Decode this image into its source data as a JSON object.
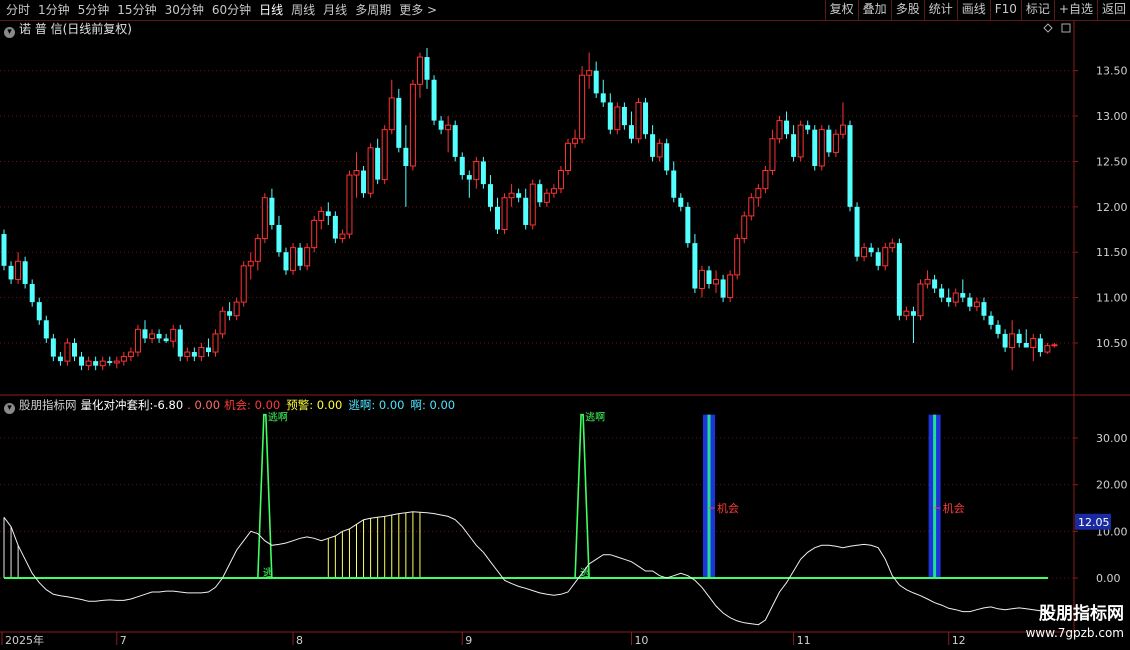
{
  "toolbar": {
    "periods": [
      "分时",
      "1分钟",
      "5分钟",
      "15分钟",
      "30分钟",
      "60分钟",
      "日线",
      "周线",
      "月线",
      "多周期",
      "更多 >"
    ],
    "active_period": "日线",
    "right_buttons": [
      "复权",
      "叠加",
      "多股",
      "统计",
      "画线",
      "F10",
      "标记",
      "+自选",
      "返回"
    ]
  },
  "price_panel": {
    "title": "诺 普 信(日线前复权)",
    "y_ticks": [
      "13.50",
      "13.00",
      "12.50",
      "12.00",
      "11.50",
      "11.00",
      "10.50"
    ],
    "y_tick_values": [
      13.5,
      13.0,
      12.5,
      12.0,
      11.5,
      11.0,
      10.5
    ],
    "y_range": [
      10.07,
      13.86
    ],
    "up_color": "#ff3232",
    "down_color": "#54ffff"
  },
  "indicator_panel": {
    "title": "股朋指标网",
    "name": "量化对冲套利:",
    "value": "-6.80",
    "extra": ". 0.00",
    "fields": [
      {
        "label": "机会: 0.00",
        "color": "#ff3a3a"
      },
      {
        "label": "预警: 0.00",
        "color": "#ffff40"
      },
      {
        "label": "逃啊: 0.00",
        "color": "#4ce4ff"
      },
      {
        "label": "啊: 0.00",
        "color": "#4ce4ff"
      }
    ],
    "y_ticks": [
      "30.00",
      "20.00",
      "10.00",
      "0.00"
    ],
    "y_tick_values": [
      30,
      20,
      10,
      0
    ],
    "y_range": [
      -10,
      35
    ],
    "current_value_label": "12.05",
    "annot_escape_top": "逃啊",
    "annot_escape_bottom": "逃",
    "annot_opportunity": "机会"
  },
  "x_axis": {
    "labels": [
      "2025年",
      "7",
      "8",
      "9",
      "10",
      "11",
      "12"
    ],
    "label_bars": [
      0,
      16,
      41,
      65,
      89,
      112,
      134
    ]
  },
  "watermark": {
    "title": "股朋指标网",
    "url": "www.7gpzb.com"
  },
  "chart_data": {
    "type": "candlestick",
    "bar_count": 150,
    "ohlc": [
      [
        11.7,
        11.75,
        11.3,
        11.35
      ],
      [
        11.35,
        11.4,
        11.15,
        11.2
      ],
      [
        11.2,
        11.5,
        11.15,
        11.4
      ],
      [
        11.4,
        11.45,
        11.1,
        11.15
      ],
      [
        11.15,
        11.2,
        10.9,
        10.95
      ],
      [
        10.95,
        11.0,
        10.7,
        10.75
      ],
      [
        10.75,
        10.8,
        10.5,
        10.55
      ],
      [
        10.55,
        10.6,
        10.3,
        10.35
      ],
      [
        10.35,
        10.4,
        10.25,
        10.3
      ],
      [
        10.3,
        10.55,
        10.25,
        10.5
      ],
      [
        10.5,
        10.55,
        10.3,
        10.35
      ],
      [
        10.35,
        10.4,
        10.2,
        10.25
      ],
      [
        10.25,
        10.35,
        10.2,
        10.3
      ],
      [
        10.3,
        10.35,
        10.2,
        10.25
      ],
      [
        10.25,
        10.35,
        10.2,
        10.3
      ],
      [
        10.3,
        10.35,
        10.25,
        10.28
      ],
      [
        10.28,
        10.35,
        10.22,
        10.3
      ],
      [
        10.3,
        10.4,
        10.25,
        10.35
      ],
      [
        10.35,
        10.45,
        10.3,
        10.4
      ],
      [
        10.4,
        10.7,
        10.35,
        10.65
      ],
      [
        10.65,
        10.75,
        10.5,
        10.55
      ],
      [
        10.55,
        10.65,
        10.5,
        10.6
      ],
      [
        10.6,
        10.65,
        10.5,
        10.55
      ],
      [
        10.55,
        10.6,
        10.5,
        10.52
      ],
      [
        10.52,
        10.7,
        10.45,
        10.65
      ],
      [
        10.65,
        10.7,
        10.3,
        10.35
      ],
      [
        10.35,
        10.45,
        10.3,
        10.4
      ],
      [
        10.4,
        10.45,
        10.3,
        10.35
      ],
      [
        10.35,
        10.5,
        10.3,
        10.45
      ],
      [
        10.45,
        10.55,
        10.35,
        10.4
      ],
      [
        10.4,
        10.65,
        10.35,
        10.6
      ],
      [
        10.6,
        10.9,
        10.55,
        10.85
      ],
      [
        10.85,
        10.95,
        10.75,
        10.8
      ],
      [
        10.8,
        11.0,
        10.75,
        10.95
      ],
      [
        10.95,
        11.4,
        10.9,
        11.35
      ],
      [
        11.35,
        11.5,
        11.2,
        11.4
      ],
      [
        11.4,
        11.7,
        11.3,
        11.65
      ],
      [
        11.65,
        12.15,
        11.6,
        12.1
      ],
      [
        12.1,
        12.2,
        11.75,
        11.8
      ],
      [
        11.8,
        11.9,
        11.45,
        11.5
      ],
      [
        11.5,
        11.55,
        11.25,
        11.3
      ],
      [
        11.3,
        11.6,
        11.25,
        11.55
      ],
      [
        11.55,
        11.6,
        11.3,
        11.35
      ],
      [
        11.35,
        11.6,
        11.3,
        11.55
      ],
      [
        11.55,
        11.9,
        11.5,
        11.85
      ],
      [
        11.85,
        12.0,
        11.75,
        11.95
      ],
      [
        11.95,
        12.05,
        11.8,
        11.9
      ],
      [
        11.9,
        11.95,
        11.6,
        11.65
      ],
      [
        11.65,
        11.75,
        11.6,
        11.7
      ],
      [
        11.7,
        12.4,
        11.65,
        12.35
      ],
      [
        12.35,
        12.6,
        12.1,
        12.4
      ],
      [
        12.4,
        12.45,
        12.1,
        12.15
      ],
      [
        12.15,
        12.7,
        12.1,
        12.65
      ],
      [
        12.65,
        12.75,
        12.25,
        12.3
      ],
      [
        12.3,
        12.9,
        12.25,
        12.85
      ],
      [
        12.85,
        13.4,
        12.8,
        13.2
      ],
      [
        13.2,
        13.3,
        12.6,
        12.65
      ],
      [
        12.65,
        12.9,
        12.0,
        12.45
      ],
      [
        12.45,
        13.4,
        12.4,
        13.35
      ],
      [
        13.35,
        13.7,
        13.2,
        13.65
      ],
      [
        13.65,
        13.75,
        13.3,
        13.4
      ],
      [
        13.4,
        13.45,
        12.9,
        12.95
      ],
      [
        12.95,
        13.0,
        12.8,
        12.85
      ],
      [
        12.85,
        13.0,
        12.6,
        12.9
      ],
      [
        12.9,
        12.95,
        12.5,
        12.55
      ],
      [
        12.55,
        12.6,
        12.3,
        12.35
      ],
      [
        12.35,
        12.4,
        12.1,
        12.3
      ],
      [
        12.3,
        12.55,
        12.2,
        12.5
      ],
      [
        12.5,
        12.55,
        12.2,
        12.25
      ],
      [
        12.25,
        12.35,
        11.95,
        12.0
      ],
      [
        12.0,
        12.1,
        11.7,
        11.75
      ],
      [
        11.75,
        12.15,
        11.7,
        12.1
      ],
      [
        12.1,
        12.25,
        12.0,
        12.15
      ],
      [
        12.15,
        12.2,
        12.05,
        12.1
      ],
      [
        12.1,
        12.2,
        11.75,
        11.8
      ],
      [
        11.8,
        12.3,
        11.75,
        12.25
      ],
      [
        12.25,
        12.3,
        12.0,
        12.05
      ],
      [
        12.05,
        12.2,
        12.0,
        12.15
      ],
      [
        12.15,
        12.25,
        12.1,
        12.2
      ],
      [
        12.2,
        12.45,
        12.15,
        12.4
      ],
      [
        12.4,
        12.75,
        12.35,
        12.7
      ],
      [
        12.7,
        12.85,
        12.65,
        12.75
      ],
      [
        12.75,
        13.55,
        12.7,
        13.45
      ],
      [
        13.45,
        13.7,
        13.3,
        13.5
      ],
      [
        13.5,
        13.6,
        13.2,
        13.25
      ],
      [
        13.25,
        13.4,
        13.1,
        13.15
      ],
      [
        13.15,
        13.25,
        12.8,
        12.85
      ],
      [
        12.85,
        13.15,
        12.8,
        13.1
      ],
      [
        13.1,
        13.15,
        12.85,
        12.9
      ],
      [
        12.9,
        13.05,
        12.7,
        12.75
      ],
      [
        12.75,
        13.2,
        12.7,
        13.15
      ],
      [
        13.15,
        13.2,
        12.75,
        12.8
      ],
      [
        12.8,
        12.9,
        12.5,
        12.55
      ],
      [
        12.55,
        12.75,
        12.5,
        12.7
      ],
      [
        12.7,
        12.75,
        12.35,
        12.4
      ],
      [
        12.4,
        12.5,
        12.05,
        12.1
      ],
      [
        12.1,
        12.15,
        11.95,
        12.0
      ],
      [
        12.0,
        12.05,
        11.55,
        11.6
      ],
      [
        11.6,
        11.7,
        11.05,
        11.1
      ],
      [
        11.1,
        11.35,
        11.0,
        11.3
      ],
      [
        11.3,
        11.35,
        11.1,
        11.15
      ],
      [
        11.15,
        11.3,
        11.05,
        11.2
      ],
      [
        11.2,
        11.25,
        10.95,
        11.0
      ],
      [
        11.0,
        11.3,
        10.95,
        11.25
      ],
      [
        11.25,
        11.7,
        11.2,
        11.65
      ],
      [
        11.65,
        11.95,
        11.6,
        11.9
      ],
      [
        11.9,
        12.15,
        11.85,
        12.1
      ],
      [
        12.1,
        12.25,
        12.0,
        12.2
      ],
      [
        12.2,
        12.45,
        12.15,
        12.4
      ],
      [
        12.4,
        12.85,
        12.35,
        12.75
      ],
      [
        12.75,
        13.0,
        12.7,
        12.95
      ],
      [
        12.95,
        13.05,
        12.75,
        12.8
      ],
      [
        12.8,
        12.9,
        12.5,
        12.55
      ],
      [
        12.55,
        12.95,
        12.5,
        12.9
      ],
      [
        12.9,
        12.95,
        12.8,
        12.85
      ],
      [
        12.85,
        12.9,
        12.4,
        12.45
      ],
      [
        12.45,
        12.9,
        12.4,
        12.85
      ],
      [
        12.85,
        12.9,
        12.55,
        12.6
      ],
      [
        12.6,
        12.85,
        12.55,
        12.8
      ],
      [
        12.8,
        13.15,
        12.75,
        12.9
      ],
      [
        12.9,
        12.95,
        11.95,
        12.0
      ],
      [
        12.0,
        12.05,
        11.4,
        11.45
      ],
      [
        11.45,
        11.6,
        11.4,
        11.55
      ],
      [
        11.55,
        11.6,
        11.45,
        11.5
      ],
      [
        11.5,
        11.55,
        11.3,
        11.35
      ],
      [
        11.35,
        11.6,
        11.3,
        11.55
      ],
      [
        11.55,
        11.65,
        11.5,
        11.6
      ],
      [
        11.6,
        11.65,
        10.75,
        10.8
      ],
      [
        10.8,
        10.9,
        10.75,
        10.85
      ],
      [
        10.85,
        10.9,
        10.5,
        10.8
      ],
      [
        10.8,
        11.2,
        10.75,
        11.15
      ],
      [
        11.15,
        11.3,
        11.1,
        11.2
      ],
      [
        11.2,
        11.25,
        11.05,
        11.1
      ],
      [
        11.1,
        11.15,
        10.95,
        11.0
      ],
      [
        11.0,
        11.1,
        10.9,
        10.95
      ],
      [
        10.95,
        11.1,
        10.9,
        11.05
      ],
      [
        11.05,
        11.2,
        10.95,
        11.0
      ],
      [
        11.0,
        11.05,
        10.85,
        10.9
      ],
      [
        10.9,
        11.0,
        10.85,
        10.95
      ],
      [
        10.95,
        11.0,
        10.75,
        10.8
      ],
      [
        10.8,
        10.85,
        10.65,
        10.7
      ],
      [
        10.7,
        10.75,
        10.55,
        10.6
      ],
      [
        10.6,
        10.65,
        10.4,
        10.45
      ],
      [
        10.45,
        10.75,
        10.2,
        10.6
      ],
      [
        10.6,
        10.65,
        10.45,
        10.5
      ],
      [
        10.5,
        10.65,
        10.45,
        10.45
      ],
      [
        10.45,
        10.6,
        10.3,
        10.55
      ],
      [
        10.55,
        10.6,
        10.35,
        10.4
      ],
      [
        10.4,
        10.5,
        10.38,
        10.47
      ],
      [
        10.47,
        10.5,
        10.45,
        10.48
      ]
    ],
    "indicator": {
      "series": [
        {
          "name": "量化对冲套利",
          "values": [
            13,
            11,
            7,
            4,
            1,
            -1,
            -2.5,
            -3.5,
            -3.8,
            -4,
            -4.3,
            -4.6,
            -5,
            -5,
            -4.8,
            -4.7,
            -4.8,
            -4.8,
            -4.5,
            -4,
            -3.5,
            -3,
            -3,
            -2.8,
            -2.8,
            -3,
            -3.2,
            -3.2,
            -3.2,
            -3,
            -2,
            0,
            3,
            6,
            8,
            10,
            9.5,
            8,
            7,
            7.2,
            7.5,
            8,
            8.5,
            8.8,
            8.5,
            8,
            8.5,
            9,
            10,
            10.5,
            11.5,
            12.5,
            12.8,
            13,
            13.2,
            13.5,
            13.8,
            14,
            14.2,
            14.1,
            14,
            13.8,
            13.5,
            13.2,
            12.5,
            11,
            9,
            7,
            5.5,
            3.5,
            1.5,
            -0.5,
            -1.2,
            -1.8,
            -2.2,
            -2.7,
            -3.2,
            -3.5,
            -3.7,
            -3.5,
            -3,
            -1,
            1,
            3,
            4,
            5,
            5,
            4.5,
            4,
            3.5,
            2.5,
            1.5,
            1.5,
            0.5,
            0,
            0.5,
            1,
            0.5,
            -0.5,
            -2,
            -4,
            -6,
            -7.5,
            -8.5,
            -9.2,
            -9.6,
            -9.8,
            -10,
            -9,
            -6,
            -3,
            -1,
            1.5,
            4,
            5.5,
            6.5,
            7,
            7,
            6.8,
            6.5,
            6.8,
            7,
            7.2,
            7,
            6.5,
            4,
            0.5,
            -1.5,
            -2.5,
            -3.2,
            -3.8,
            -4.5,
            -5.3,
            -5.8,
            -6.5,
            -6.8,
            -7.2,
            -7.2,
            -6.8,
            -6.4,
            -6.2,
            -6.6,
            -6.8,
            -6.6,
            -6.4,
            -6.6,
            -6.8,
            -7,
            -7.2,
            -7.5
          ]
        }
      ],
      "escape_spikes": [
        {
          "bar": 37,
          "value": 35
        },
        {
          "bar": 82,
          "value": 35
        }
      ],
      "opportunity_bars": [
        {
          "bar": 100
        },
        {
          "bar": 132
        }
      ],
      "warning_range": [
        46,
        59
      ]
    }
  }
}
